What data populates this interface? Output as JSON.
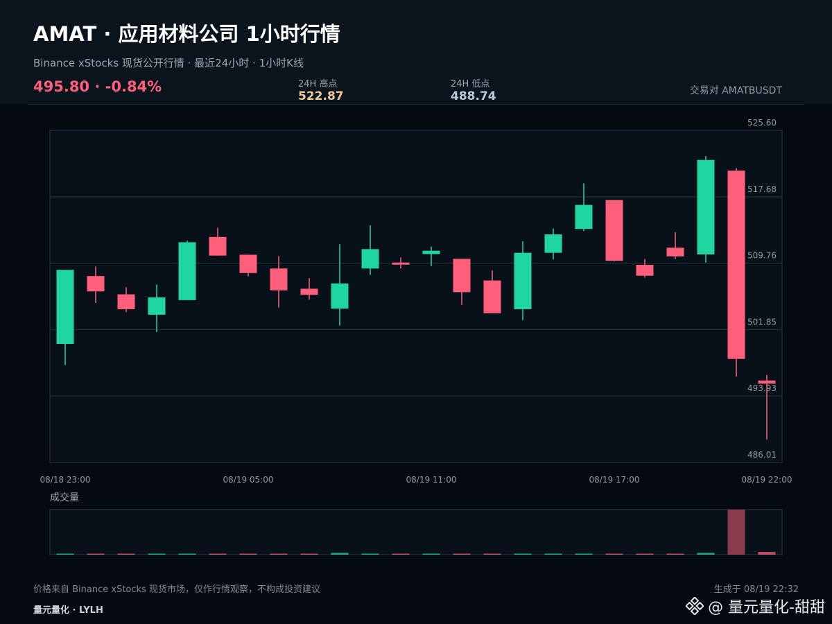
{
  "header": {
    "title": "AMAT · 应用材料公司 1小时行情",
    "subtitle": "Binance xStocks 现货公开行情 · 最近24小时 · 1小时K线",
    "price_change": "495.80 · -0.84%",
    "high_label": "24H 高点",
    "high_value": "522.87",
    "low_label": "24H 低点",
    "low_value": "488.74",
    "pair": "交易对 AMATBUSDT"
  },
  "colors": {
    "up": "#1fd5a0",
    "down": "#ff5f7b",
    "grid": "#1c2a36",
    "volume_spike": "#8a3c4f"
  },
  "chart_data": {
    "type": "candlestick",
    "x_tick_labels": [
      "08/18 23:00",
      "08/19 05:00",
      "08/19 11:00",
      "08/19 17:00",
      "08/19 22:00"
    ],
    "y_tick_labels": [
      "525.60",
      "517.68",
      "509.76",
      "501.85",
      "493.93",
      "486.01"
    ],
    "ylim": [
      486.01,
      525.6
    ],
    "volume_label": "成交量",
    "candles": [
      {
        "o": 500.14,
        "h": 508.38,
        "l": 497.62,
        "c": 508.97
      },
      {
        "o": 508.23,
        "h": 509.37,
        "l": 505.02,
        "c": 506.4
      },
      {
        "o": 506.05,
        "h": 506.89,
        "l": 503.93,
        "c": 504.28
      },
      {
        "o": 503.62,
        "h": 507.21,
        "l": 501.55,
        "c": 505.69
      },
      {
        "o": 505.36,
        "h": 512.46,
        "l": 505.36,
        "c": 512.26
      },
      {
        "o": 512.89,
        "h": 513.99,
        "l": 510.85,
        "c": 510.67
      },
      {
        "o": 510.77,
        "h": 510.77,
        "l": 508.19,
        "c": 508.59
      },
      {
        "o": 509.13,
        "h": 510.6,
        "l": 504.48,
        "c": 506.53
      },
      {
        "o": 506.72,
        "h": 507.99,
        "l": 505.42,
        "c": 506.0
      },
      {
        "o": 504.35,
        "h": 512.03,
        "l": 502.32,
        "c": 507.35
      },
      {
        "o": 509.13,
        "h": 514.28,
        "l": 508.38,
        "c": 511.44
      },
      {
        "o": 509.84,
        "h": 510.45,
        "l": 509.13,
        "c": 509.62
      },
      {
        "o": 510.85,
        "h": 511.74,
        "l": 509.4,
        "c": 511.25
      },
      {
        "o": 510.29,
        "h": 510.29,
        "l": 504.79,
        "c": 506.31
      },
      {
        "o": 507.7,
        "h": 508.91,
        "l": 503.8,
        "c": 503.8
      },
      {
        "o": 504.28,
        "h": 512.37,
        "l": 502.98,
        "c": 511.0
      },
      {
        "o": 511.0,
        "h": 513.9,
        "l": 510.22,
        "c": 513.2
      },
      {
        "o": 513.85,
        "h": 519.28,
        "l": 513.6,
        "c": 516.71
      },
      {
        "o": 517.3,
        "h": 517.3,
        "l": 510.0,
        "c": 510.05
      },
      {
        "o": 509.56,
        "h": 510.26,
        "l": 508.03,
        "c": 508.27
      },
      {
        "o": 511.61,
        "h": 513.46,
        "l": 510.23,
        "c": 510.58
      },
      {
        "o": 510.81,
        "h": 522.54,
        "l": 509.84,
        "c": 522.07
      },
      {
        "o": 520.8,
        "h": 521.11,
        "l": 496.24,
        "c": 498.35
      },
      {
        "o": 495.78,
        "h": 496.45,
        "l": 488.74,
        "c": 495.4
      }
    ],
    "volume": [
      0.02,
      0.02,
      0.02,
      0.02,
      0.02,
      0.02,
      0.02,
      0.02,
      0.02,
      0.04,
      0.02,
      0.02,
      0.02,
      0.02,
      0.02,
      0.02,
      0.02,
      0.02,
      0.02,
      0.02,
      0.02,
      0.04,
      1.0,
      0.06
    ],
    "volume_note": "relative to max volume bar"
  },
  "footer": {
    "note": "价格来自 Binance xStocks 现货市场，仅作行情观察，不构成投资建议",
    "generated": "生成于 08/19 22:32",
    "brand": "量元量化 · LYLH",
    "watermark": "@ 量元量化-甜甜"
  }
}
